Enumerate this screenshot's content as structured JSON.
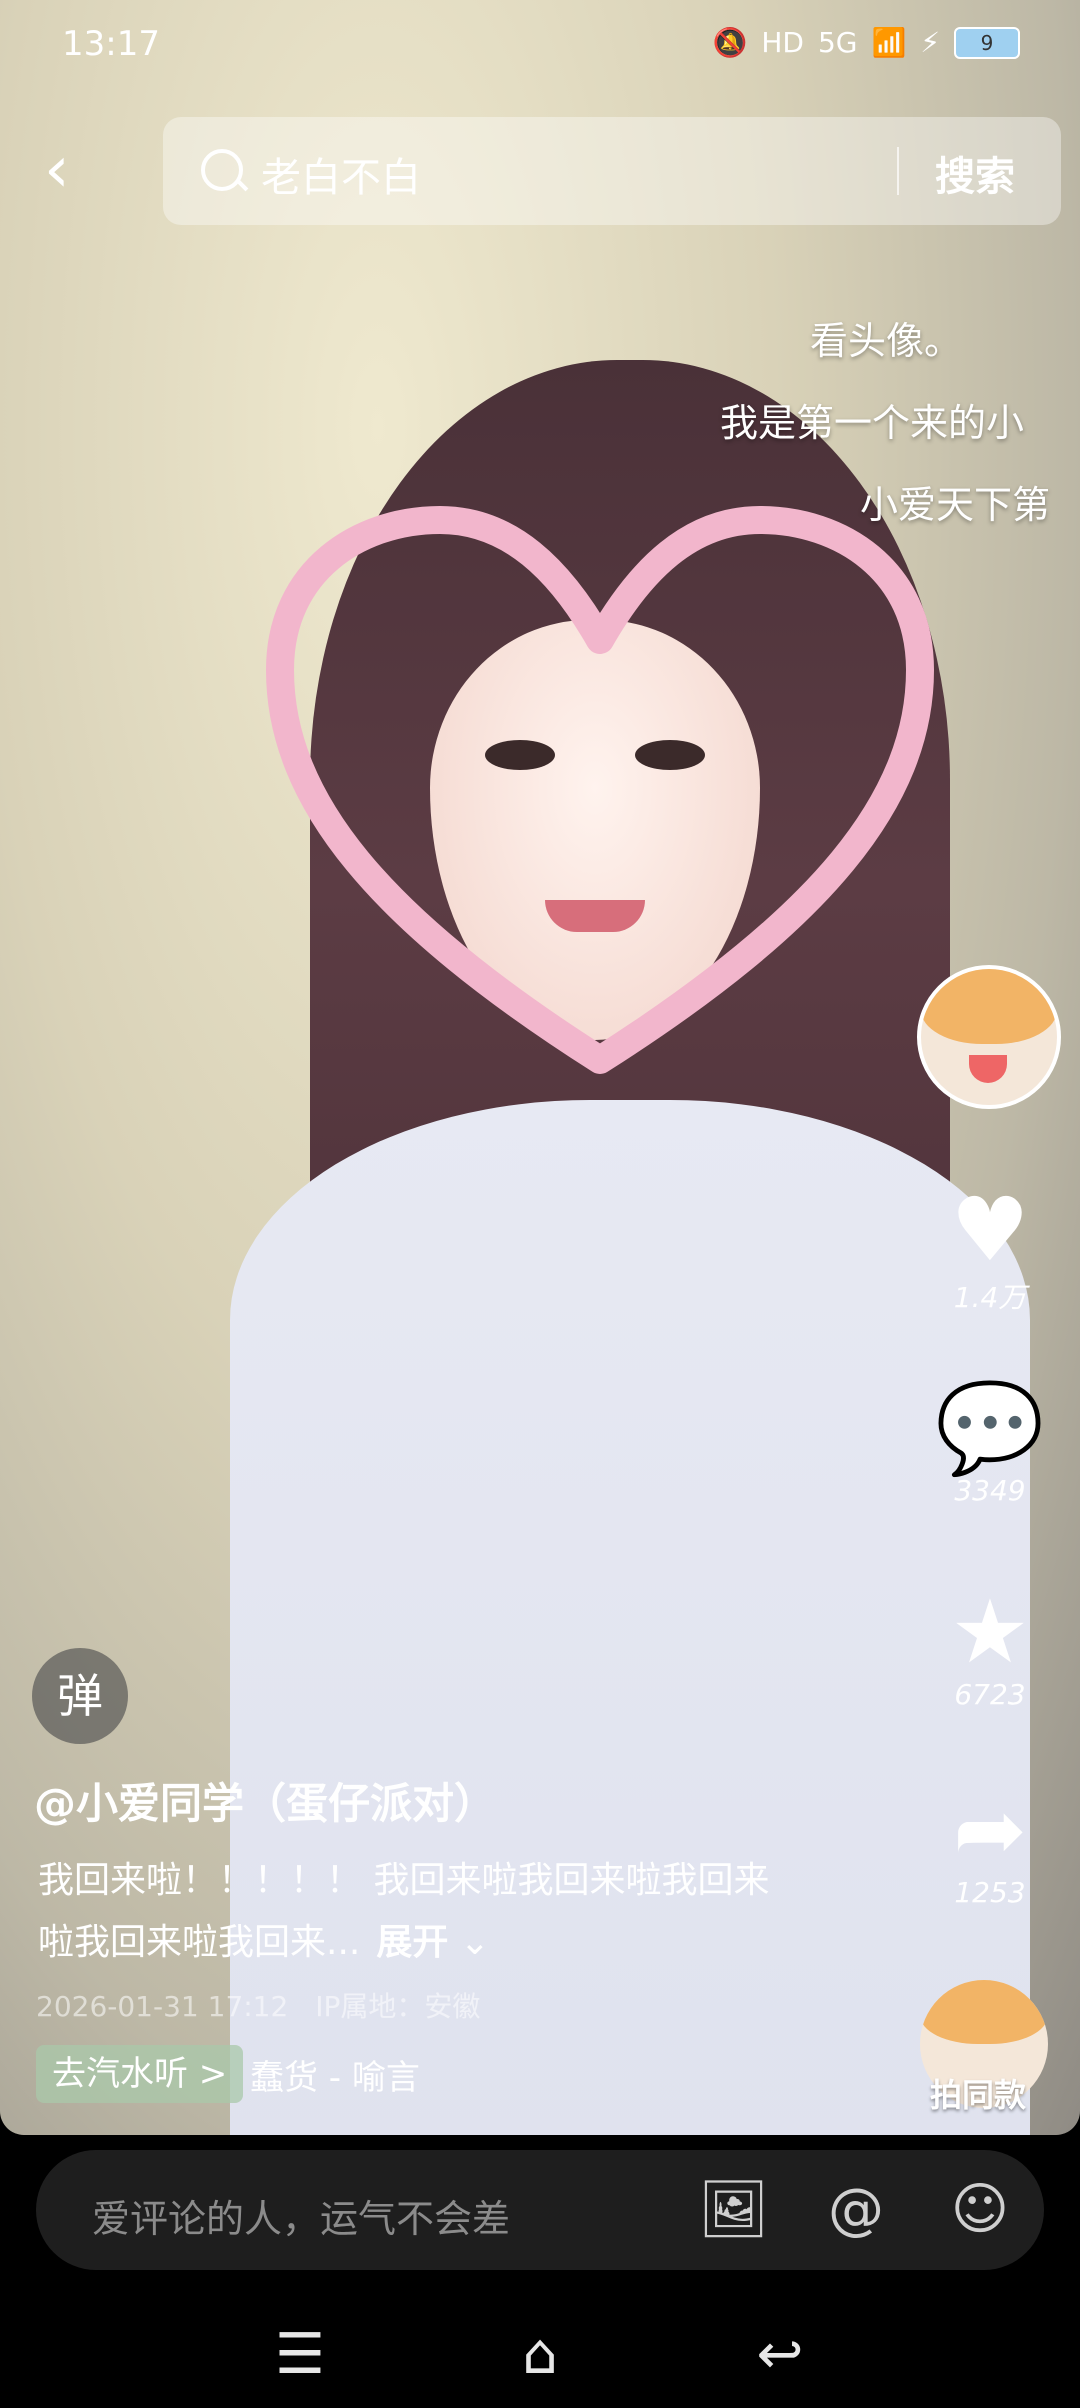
{
  "status_bar": {
    "time": "13:17",
    "network": "5G",
    "battery": "9"
  },
  "search": {
    "value": "老白不白",
    "button": "搜索"
  },
  "overlay_lines": [
    "看头像。",
    "我是第一个来的小",
    "小爱天下第"
  ],
  "actions": {
    "like": "1.4万",
    "comment": "3349",
    "favorite": "6723",
    "share": "1253",
    "same_style": "拍同款"
  },
  "post": {
    "danmu_label": "弹",
    "author": "@小爱同学（蛋仔派对）",
    "description": "我回来啦！！！！！ 我回来啦我回来啦我回来啦我回来啦我回来...",
    "expand": "展开",
    "datetime": "2026-01-31 17:12",
    "ip": "IP属地：安徽",
    "music_tag": "去汽水听 >",
    "music": "蠢货 - 喻言"
  },
  "comment_bar": {
    "placeholder": "爱评论的人，运气不会差"
  }
}
